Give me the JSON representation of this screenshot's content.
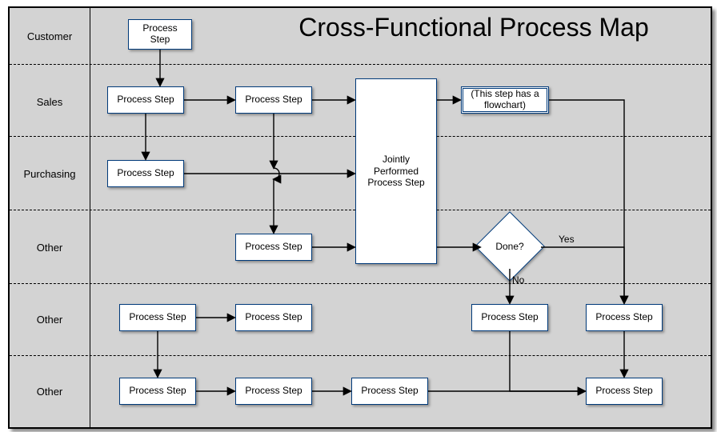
{
  "title": "Cross-Functional Process Map",
  "lanes": [
    {
      "label": "Customer"
    },
    {
      "label": "Sales"
    },
    {
      "label": "Purchasing"
    },
    {
      "label": "Other"
    },
    {
      "label": "Other"
    },
    {
      "label": "Other"
    }
  ],
  "steps": {
    "customerStep": "Process Step",
    "salesStep1": "Process Step",
    "salesStep2": "Process Step",
    "salesSub": "(This step has a flowchart)",
    "purchasingStep": "Process Step",
    "jointStep": "Jointly Performed Process Step",
    "other1Step": "Process Step",
    "decision": "Done?",
    "decisionYes": "Yes",
    "decisionNo": "No",
    "other2Step1": "Process Step",
    "other2Step2": "Process Step",
    "other2Step3": "Process Step",
    "other2Step4": "Process Step",
    "other3Step1": "Process Step",
    "other3Step2": "Process Step",
    "other3Step3": "Process Step",
    "other3Step4": "Process Step"
  }
}
